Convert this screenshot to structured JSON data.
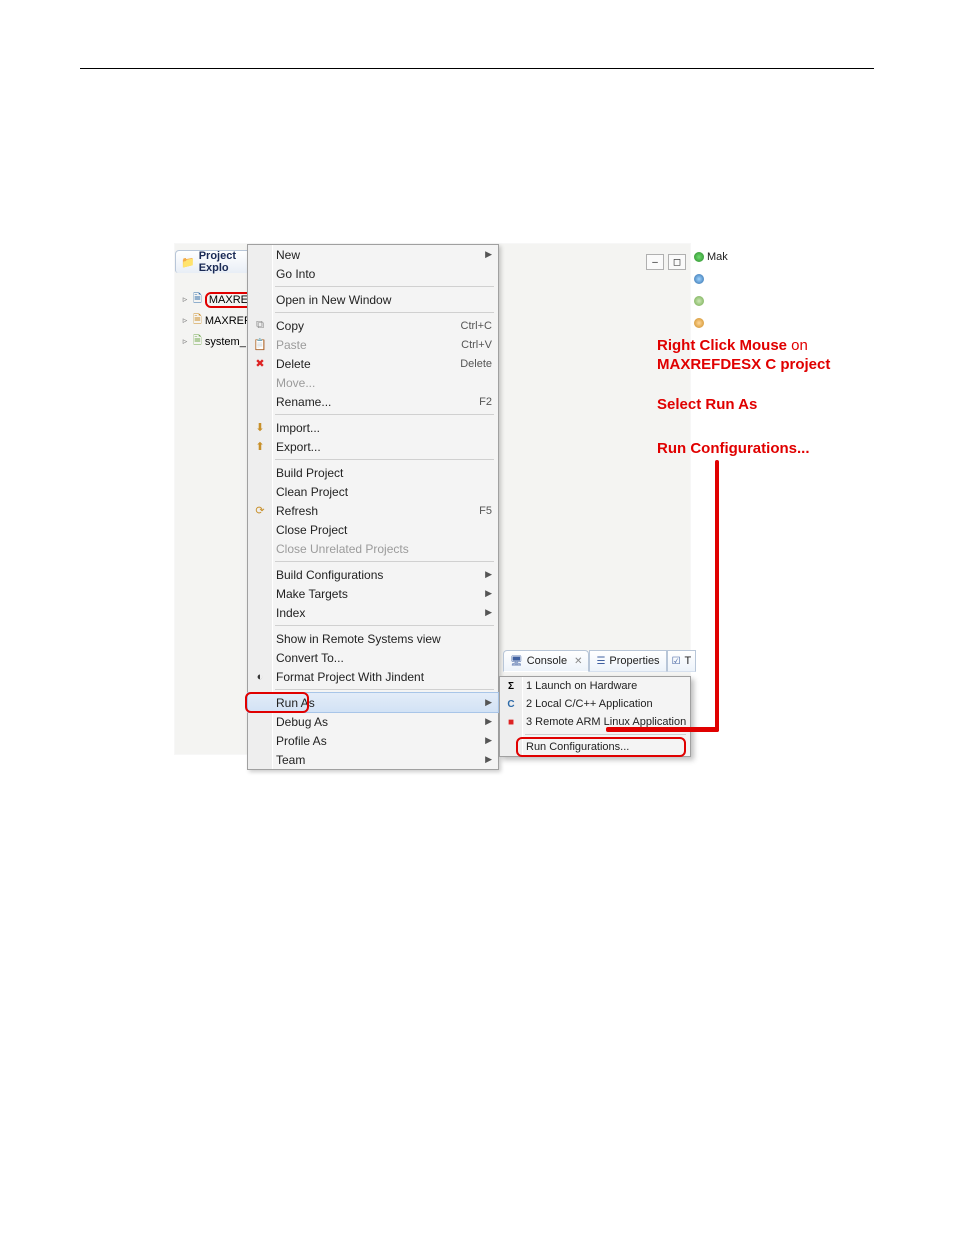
{
  "project_explorer": {
    "tab_label": "Project Explo"
  },
  "tree": {
    "items": [
      {
        "label": "MAXREF",
        "highlighted": true,
        "icon": "c-project"
      },
      {
        "label": "MAXREF",
        "highlighted": false,
        "icon": "hw-project"
      },
      {
        "label": "system_",
        "highlighted": false,
        "icon": "bsp-project"
      }
    ]
  },
  "right_strip": {
    "make_label": "Mak"
  },
  "context_menu": {
    "groups": [
      [
        {
          "label": "New",
          "arrow": true
        },
        {
          "label": "Go Into"
        }
      ],
      [
        {
          "label": "Open in New Window"
        }
      ],
      [
        {
          "label": "Copy",
          "accel": "Ctrl+C",
          "icon": "copy-icon"
        },
        {
          "label": "Paste",
          "accel": "Ctrl+V",
          "icon": "paste-icon",
          "disabled": true
        },
        {
          "label": "Delete",
          "accel": "Delete",
          "icon": "delete-icon"
        },
        {
          "label": "Move...",
          "disabled": true
        },
        {
          "label": "Rename...",
          "accel": "F2"
        }
      ],
      [
        {
          "label": "Import...",
          "icon": "import-icon"
        },
        {
          "label": "Export...",
          "icon": "export-icon"
        }
      ],
      [
        {
          "label": "Build Project"
        },
        {
          "label": "Clean Project"
        },
        {
          "label": "Refresh",
          "accel": "F5",
          "icon": "refresh-icon"
        },
        {
          "label": "Close Project"
        },
        {
          "label": "Close Unrelated Projects",
          "disabled": true
        }
      ],
      [
        {
          "label": "Build Configurations",
          "arrow": true
        },
        {
          "label": "Make Targets",
          "arrow": true
        },
        {
          "label": "Index",
          "arrow": true
        }
      ],
      [
        {
          "label": "Show in Remote Systems view"
        },
        {
          "label": "Convert To..."
        },
        {
          "label": "Format Project With Jindent",
          "icon": "jindent-icon"
        }
      ],
      [
        {
          "label": "Run As",
          "arrow": true,
          "highlight": true,
          "red_box": true
        },
        {
          "label": "Debug As",
          "arrow": true
        },
        {
          "label": "Profile As",
          "arrow": true
        },
        {
          "label": "Team",
          "arrow": true
        }
      ]
    ]
  },
  "bottom_tabs": {
    "console": "Console",
    "properties": "Properties"
  },
  "run_as_submenu": {
    "items": [
      {
        "label": "1 Launch on Hardware",
        "icon": "sigma-icon"
      },
      {
        "label": "2 Local C/C++ Application",
        "icon": "c-app-icon"
      },
      {
        "label": "3 Remote ARM Linux Application",
        "icon": "remote-icon"
      }
    ],
    "last": {
      "label": "Run Configurations...",
      "red_box": true
    }
  },
  "annotations": {
    "line1a": "Right Click Mouse",
    "line1b": " on",
    "line1c": "MAXREFDESX C project",
    "line2": "Select Run As",
    "line3": "Run Configurations..."
  }
}
